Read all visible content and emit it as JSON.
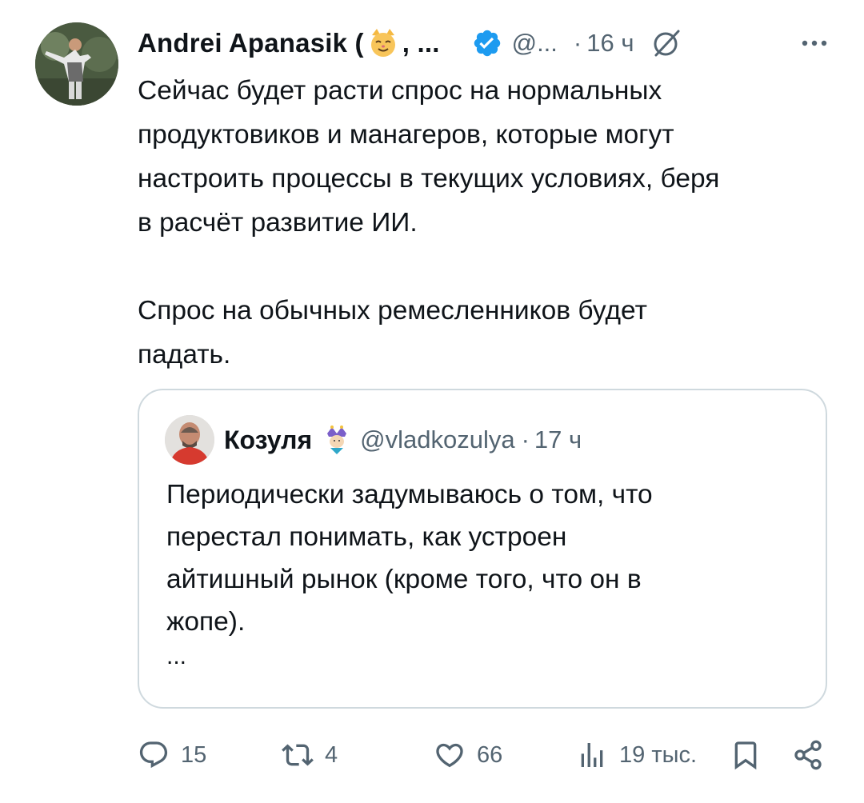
{
  "author": {
    "name": "Andrei Apanasik (",
    "name_suffix": ", ...",
    "handle": "@...",
    "dot": "·",
    "time": "16 ч"
  },
  "tweet": {
    "paragraph1": "Сейчас будет расти спрос на нормальных\nпродуктовиков и манагеров, которые могут\nнастроить процессы в текущих условиях, беря\nв расчёт развитие ИИ.",
    "paragraph2": "Спрос на обычных ремесленников будет\nпадать."
  },
  "quote": {
    "name": "Козуля",
    "handle": "@vladkozulya",
    "dot": "·",
    "time": "17 ч",
    "text": "Периодически задумываюсь о том, что\nперестал понимать, как устроен\nайтишный рынок (кроме того, что он в\nжопе).",
    "ellipsis": "..."
  },
  "actions": {
    "replies": "15",
    "reposts": "4",
    "likes": "66",
    "views": "19 тыс."
  },
  "icons": {
    "avatar": "profile-photo",
    "emoji": "cat-face-icon",
    "verified": "verified-badge-icon",
    "grok": "grok-icon",
    "more": "more-icon",
    "jester": "jester-emoji-icon",
    "reply": "reply-icon",
    "repost": "repost-icon",
    "like": "heart-icon",
    "views": "views-icon",
    "bookmark": "bookmark-icon",
    "share": "share-icon"
  },
  "colors": {
    "text": "#0f1419",
    "secondary": "#536471",
    "verified": "#1d9bf0",
    "border": "#cfd9de"
  }
}
